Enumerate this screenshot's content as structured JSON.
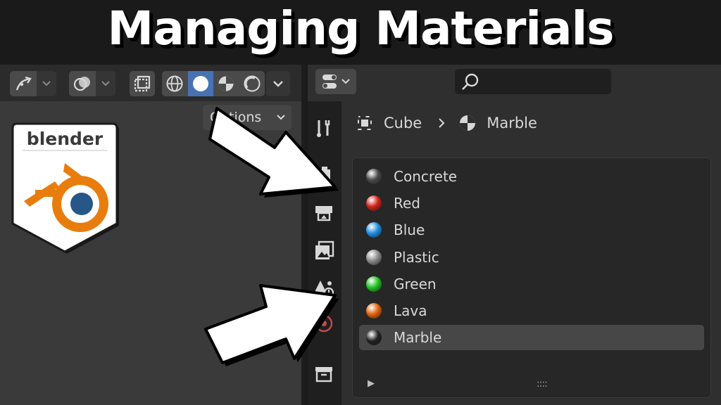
{
  "thumbnail": {
    "title": "Managing Materials"
  },
  "viewport": {
    "options_label": "Options",
    "logo_wordmark": "blender",
    "shading_modes": [
      "wireframe-icon",
      "solid-icon",
      "material-preview-icon",
      "rendered-icon"
    ],
    "active_shading": "solid-icon"
  },
  "properties": {
    "breadcrumb": {
      "object_name": "Cube",
      "material_name": "Marble"
    },
    "tabs": [
      "tool-icon",
      "render-icon",
      "output-icon",
      "view-layer-icon",
      "scene-icon",
      "world-icon",
      "collection-icon"
    ],
    "materials": [
      {
        "name": "Concrete",
        "color": "#4a4a4a"
      },
      {
        "name": "Red",
        "color": "#d0231b"
      },
      {
        "name": "Blue",
        "color": "#1f8fe0"
      },
      {
        "name": "Plastic",
        "color": "#8c8c8c"
      },
      {
        "name": "Green",
        "color": "#23c323"
      },
      {
        "name": "Lava",
        "color": "#e2640e"
      },
      {
        "name": "Marble",
        "color": "#222222"
      }
    ],
    "selected_material": "Marble",
    "grip_glyph": "::::",
    "expand_glyph": "▶"
  },
  "colors": {
    "accent": "#4772b3",
    "logo_orange": "#e87d0d",
    "logo_blue": "#265787",
    "panel_bg": "#272727"
  }
}
